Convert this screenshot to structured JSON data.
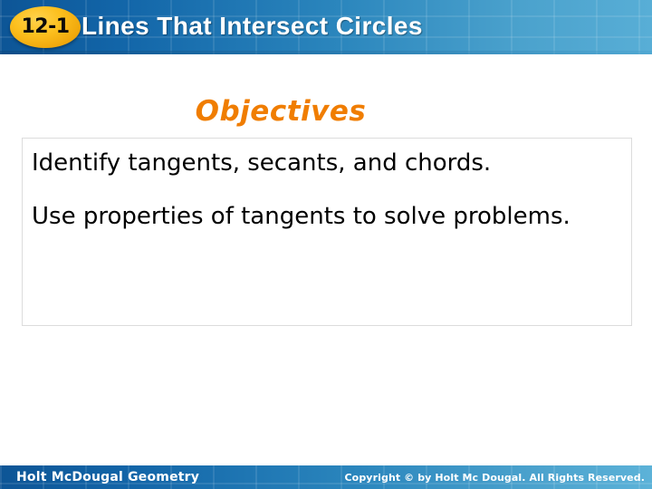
{
  "header": {
    "lesson_number": "12-1",
    "title": "Lines That Intersect Circles",
    "gradient_start_color": "#0d5596",
    "gradient_end_color": "#58aed6",
    "badge_color": "#f0a80c",
    "title_color": "#ffffff"
  },
  "slide": {
    "objectives_heading": "Objectives",
    "objectives_heading_color": "#F07D00",
    "objectives": [
      "Identify tangents, secants, and chords.",
      "Use properties of tangents to solve problems."
    ],
    "box_border_color": "#dcdcdc"
  },
  "footer": {
    "brand": "Holt McDougal Geometry",
    "copyright": "Copyright © by Holt Mc Dougal. All Rights Reserved.",
    "text_color": "#ffffff"
  }
}
